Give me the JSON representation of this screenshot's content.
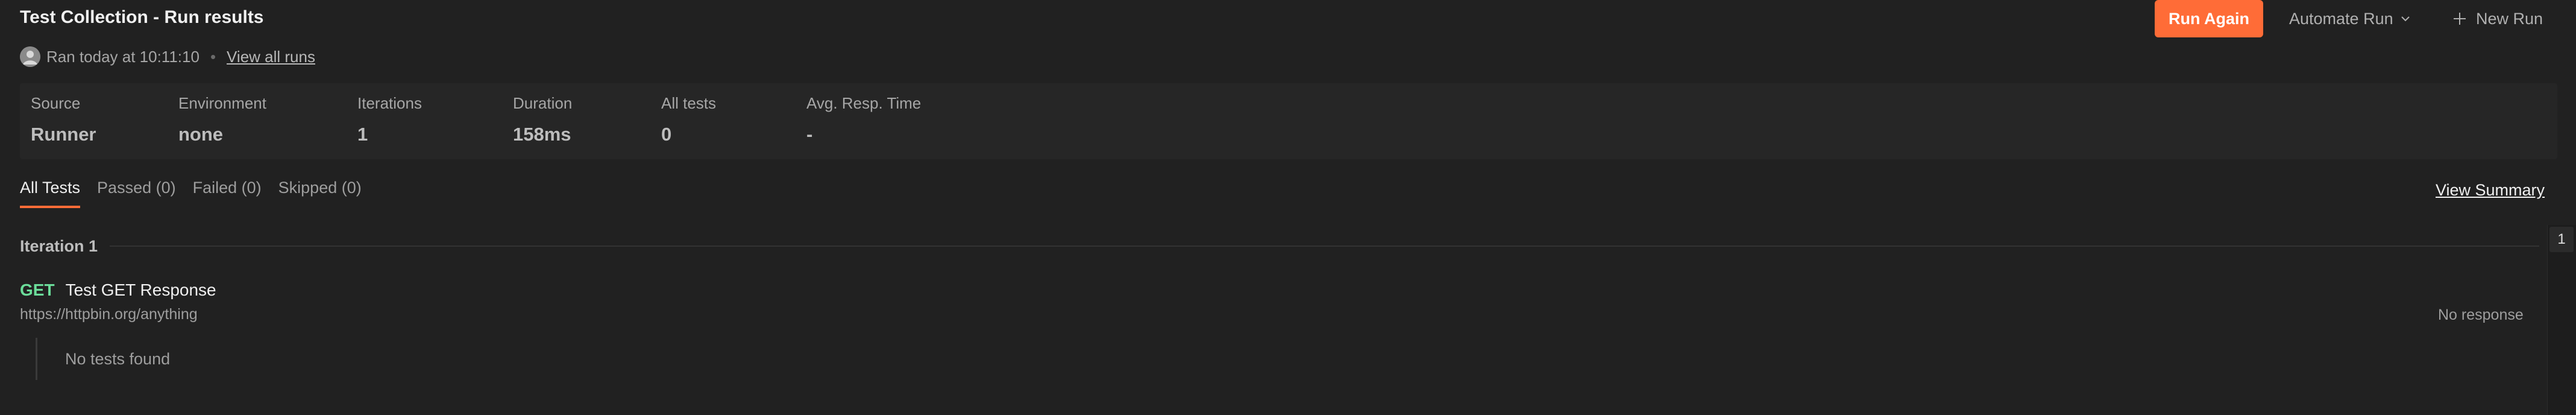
{
  "header": {
    "title": "Test Collection - Run results",
    "ran_text": "Ran today at 10:11:10",
    "separator": "•",
    "view_all_runs": "View all runs",
    "run_again": "Run Again",
    "automate_run": "Automate Run",
    "new_run": "New Run"
  },
  "stats": [
    {
      "label": "Source",
      "value": "Runner"
    },
    {
      "label": "Environment",
      "value": "none"
    },
    {
      "label": "Iterations",
      "value": "1"
    },
    {
      "label": "Duration",
      "value": "158ms"
    },
    {
      "label": "All tests",
      "value": "0"
    },
    {
      "label": "Avg. Resp. Time",
      "value": "-"
    }
  ],
  "tabs": [
    {
      "label": "All Tests",
      "active": true
    },
    {
      "label": "Passed (0)",
      "active": false
    },
    {
      "label": "Failed (0)",
      "active": false
    },
    {
      "label": "Skipped (0)",
      "active": false
    }
  ],
  "view_summary": "View Summary",
  "iteration": {
    "label": "Iteration 1",
    "jump_number": "1"
  },
  "request": {
    "method": "GET",
    "name": "Test GET Response",
    "url": "https://httpbin.org/anything",
    "response_status": "No response",
    "tests_message": "No tests found"
  },
  "colors": {
    "accent": "#ff6c37",
    "method_get": "#6bdd9a",
    "background": "#212121"
  },
  "icons": {
    "avatar": "user-avatar-icon",
    "automate_chevron": "chevron-down-icon",
    "new_run": "plus-icon"
  }
}
